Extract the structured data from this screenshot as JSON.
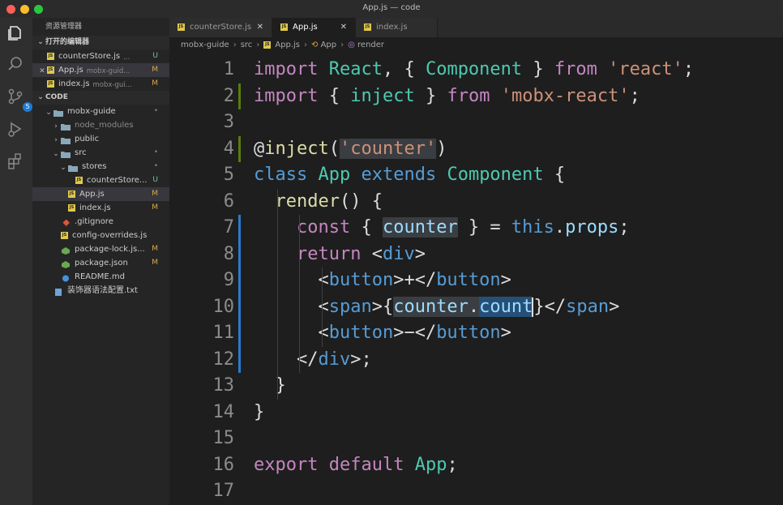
{
  "window": {
    "title": "App.js — code"
  },
  "explorer": {
    "title": "资源管理器",
    "open_editors_label": "打开的编辑器",
    "open_editors": [
      {
        "name": "counterStore.js",
        "hint": "...",
        "status": "U",
        "active": false
      },
      {
        "name": "App.js",
        "hint": "mobx-guid...",
        "status": "M",
        "active": true
      },
      {
        "name": "index.js",
        "hint": "mobx-gui...",
        "status": "M",
        "active": false
      }
    ],
    "code_label": "CODE",
    "tree": [
      {
        "name": "mobx-guide",
        "kind": "folder",
        "open": true,
        "depth": 0,
        "status": "•"
      },
      {
        "name": "node_modules",
        "kind": "folder",
        "open": false,
        "depth": 1,
        "status": "",
        "dim": true
      },
      {
        "name": "public",
        "kind": "folder",
        "open": false,
        "depth": 1,
        "status": ""
      },
      {
        "name": "src",
        "kind": "folder",
        "open": true,
        "depth": 1,
        "status": "•"
      },
      {
        "name": "stores",
        "kind": "folder",
        "open": true,
        "depth": 2,
        "status": "•"
      },
      {
        "name": "counterStore...",
        "kind": "js",
        "depth": 3,
        "status": "U"
      },
      {
        "name": "App.js",
        "kind": "js",
        "depth": 2,
        "status": "M",
        "selected": true
      },
      {
        "name": "index.js",
        "kind": "js",
        "depth": 2,
        "status": "M"
      },
      {
        "name": ".gitignore",
        "kind": "git",
        "depth": 1,
        "status": ""
      },
      {
        "name": "config-overrides.js",
        "kind": "js",
        "depth": 1,
        "status": ""
      },
      {
        "name": "package-lock.js...",
        "kind": "json",
        "depth": 1,
        "status": "M"
      },
      {
        "name": "package.json",
        "kind": "json",
        "depth": 1,
        "status": "M"
      },
      {
        "name": "README.md",
        "kind": "md",
        "depth": 1,
        "status": ""
      },
      {
        "name": "装饰器语法配置.txt",
        "kind": "txt",
        "depth": 0,
        "status": ""
      }
    ]
  },
  "scm_badge": "5",
  "tabs": [
    {
      "label": "counterStore.js",
      "active": false,
      "close": "✕"
    },
    {
      "label": "App.js",
      "active": true,
      "close": "✕"
    },
    {
      "label": "index.js",
      "active": false,
      "close": ""
    }
  ],
  "breadcrumb": [
    "mobx-guide",
    "src",
    "App.js",
    "App",
    "render"
  ],
  "colors": {
    "keyword": "#c586c0",
    "class": "#4ec9b0",
    "string": "#ce9178",
    "variable": "#9cdcfe",
    "function": "#dcdcaa",
    "tag": "#569cd6",
    "modified_gutter": "#2a7bd0",
    "added_gutter": "#587c0c"
  },
  "code": {
    "lines": [
      {
        "n": "1",
        "gutter": "",
        "tokens": [
          [
            "kw",
            "import"
          ],
          [
            "pun",
            " "
          ],
          [
            "cls",
            "React"
          ],
          [
            "pun",
            ", { "
          ],
          [
            "cls",
            "Component"
          ],
          [
            "pun",
            " } "
          ],
          [
            "kw",
            "from"
          ],
          [
            "pun",
            " "
          ],
          [
            "str",
            "'react'"
          ],
          [
            "pun",
            ";"
          ]
        ]
      },
      {
        "n": "2",
        "gutter": "added",
        "tokens": [
          [
            "kw",
            "import"
          ],
          [
            "pun",
            " { "
          ],
          [
            "cls",
            "inject"
          ],
          [
            "pun",
            " } "
          ],
          [
            "kw",
            "from"
          ],
          [
            "pun",
            " "
          ],
          [
            "str",
            "'mobx-react'"
          ],
          [
            "pun",
            ";"
          ]
        ]
      },
      {
        "n": "3",
        "gutter": "",
        "tokens": []
      },
      {
        "n": "4",
        "gutter": "added",
        "tokens": [
          [
            "pun",
            "@"
          ],
          [
            "fn",
            "inject"
          ],
          [
            "pun",
            "("
          ],
          [
            "str hl",
            "'counter'"
          ],
          [
            "pun",
            ")"
          ]
        ]
      },
      {
        "n": "5",
        "gutter": "",
        "tokens": [
          [
            "tag",
            "class"
          ],
          [
            "pun",
            " "
          ],
          [
            "cls",
            "App"
          ],
          [
            "pun",
            " "
          ],
          [
            "tag",
            "extends"
          ],
          [
            "pun",
            " "
          ],
          [
            "cls",
            "Component"
          ],
          [
            "pun",
            " {"
          ]
        ]
      },
      {
        "n": "6",
        "gutter": "",
        "tokens": [
          [
            "pun",
            "  "
          ],
          [
            "fn",
            "render"
          ],
          [
            "pun",
            "() {"
          ]
        ]
      },
      {
        "n": "7",
        "gutter": "modified",
        "tokens": [
          [
            "pun",
            "    "
          ],
          [
            "kw",
            "const"
          ],
          [
            "pun",
            " { "
          ],
          [
            "var hl",
            "counter"
          ],
          [
            "pun",
            " } = "
          ],
          [
            "tag",
            "this"
          ],
          [
            "pun",
            "."
          ],
          [
            "var",
            "props"
          ],
          [
            "pun",
            ";"
          ]
        ]
      },
      {
        "n": "8",
        "gutter": "modified",
        "tokens": [
          [
            "pun",
            "    "
          ],
          [
            "kw",
            "return"
          ],
          [
            "pun",
            " "
          ],
          [
            "pun",
            "<"
          ],
          [
            "tag",
            "div"
          ],
          [
            "pun",
            ">"
          ]
        ]
      },
      {
        "n": "9",
        "gutter": "modified",
        "tokens": [
          [
            "pun",
            "      <"
          ],
          [
            "tag",
            "button"
          ],
          [
            "pun",
            ">+</"
          ],
          [
            "tag",
            "button"
          ],
          [
            "pun",
            ">"
          ]
        ]
      },
      {
        "n": "10",
        "gutter": "modified",
        "tokens": [
          [
            "pun",
            "      <"
          ],
          [
            "tag",
            "span"
          ],
          [
            "pun",
            ">{"
          ],
          [
            "var hl",
            "counter"
          ],
          [
            "pun hl",
            "."
          ],
          [
            "var sel2",
            "count"
          ],
          [
            "cursor",
            ""
          ],
          [
            "pun",
            "}</"
          ],
          [
            "tag",
            "span"
          ],
          [
            "pun",
            ">"
          ]
        ]
      },
      {
        "n": "11",
        "gutter": "modified",
        "tokens": [
          [
            "pun",
            "      <"
          ],
          [
            "tag",
            "button"
          ],
          [
            "pun",
            ">−</"
          ],
          [
            "tag",
            "button"
          ],
          [
            "pun",
            ">"
          ]
        ]
      },
      {
        "n": "12",
        "gutter": "modified",
        "tokens": [
          [
            "pun",
            "    </"
          ],
          [
            "tag",
            "div"
          ],
          [
            "pun",
            ">;"
          ]
        ]
      },
      {
        "n": "13",
        "gutter": "",
        "tokens": [
          [
            "pun",
            "  }"
          ]
        ]
      },
      {
        "n": "14",
        "gutter": "",
        "tokens": [
          [
            "pun",
            "}"
          ]
        ]
      },
      {
        "n": "15",
        "gutter": "",
        "tokens": []
      },
      {
        "n": "16",
        "gutter": "",
        "tokens": [
          [
            "kw",
            "export"
          ],
          [
            "pun",
            " "
          ],
          [
            "kw",
            "default"
          ],
          [
            "pun",
            " "
          ],
          [
            "cls",
            "App"
          ],
          [
            "pun",
            ";"
          ]
        ]
      },
      {
        "n": "17",
        "gutter": "",
        "tokens": []
      }
    ]
  }
}
